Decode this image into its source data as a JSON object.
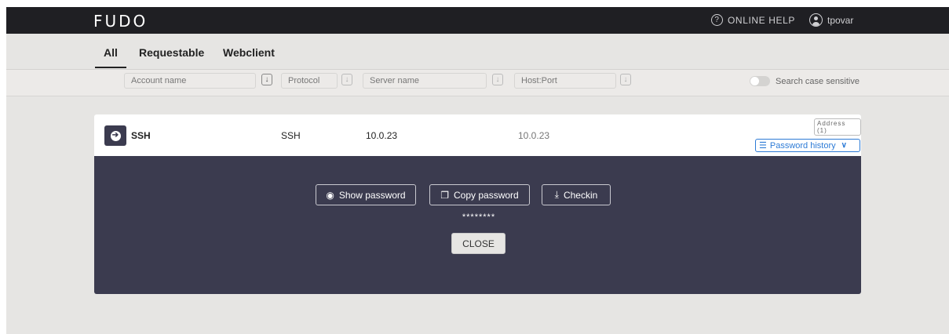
{
  "header": {
    "logo": "FUDO",
    "help_icon": "question-circle-icon",
    "help_label": "ONLINE HELP",
    "user_icon": "user-avatar-icon",
    "username": "tpovar"
  },
  "tabs": [
    {
      "label": "All",
      "active": true
    },
    {
      "label": "Requestable",
      "active": false
    },
    {
      "label": "Webclient",
      "active": false
    }
  ],
  "filters": {
    "account_placeholder": "Account name",
    "protocol_placeholder": "Protocol",
    "server_placeholder": "Server name",
    "hostport_placeholder": "Host:Port",
    "sort_icon": "↓",
    "case_sensitive_label": "Search case sensitive",
    "case_sensitive_on": false
  },
  "account": {
    "connect_icon": "➔",
    "name": "SSH",
    "protocol": "SSH",
    "server": "10.0.23",
    "host_port": "10.0.23",
    "address_badge": "Address (1)",
    "password_history_icon": "☰",
    "password_history_label": "Password history",
    "chevron_icon": "∨"
  },
  "panel": {
    "show_password_icon": "◉",
    "show_password_label": "Show password",
    "copy_password_icon": "❐",
    "copy_password_label": "Copy password",
    "checkin_icon": "⤓",
    "checkin_label": "Checkin",
    "masked_password": "********",
    "close_label": "CLOSE"
  },
  "colors": {
    "topbar": "#1f1f23",
    "panel": "#3b3b4f",
    "accent": "#2d7bd6",
    "background": "#e6e5e3"
  }
}
